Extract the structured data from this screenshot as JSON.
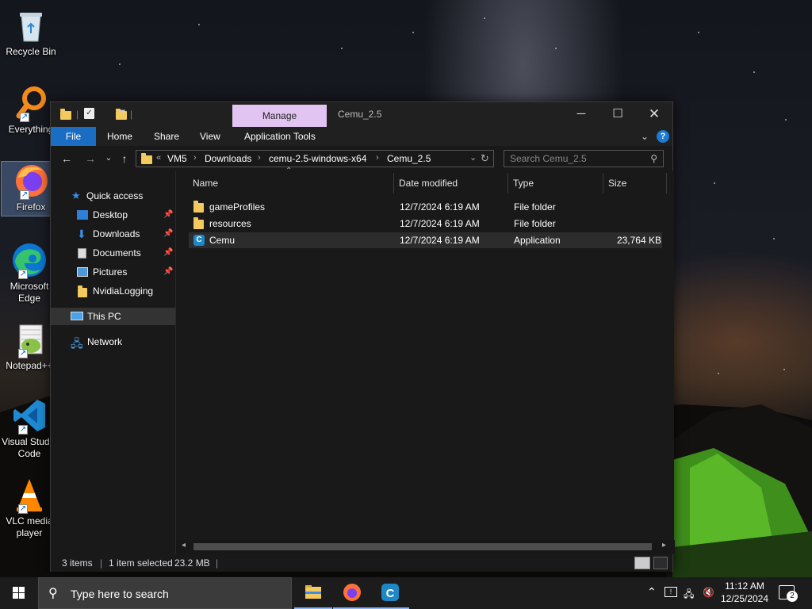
{
  "desktop": {
    "icons": [
      {
        "label": "Recycle Bin"
      },
      {
        "label": "Everything"
      },
      {
        "label": "Firefox"
      },
      {
        "label": "Microsoft Edge"
      },
      {
        "label": "Notepad++"
      },
      {
        "label": "Visual Studio Code"
      },
      {
        "label": "VLC media player"
      }
    ]
  },
  "window": {
    "title": "Cemu_2.5",
    "contextual_tab": "Manage",
    "ribbon_tabs": [
      "File",
      "Home",
      "Share",
      "View",
      "Application Tools"
    ],
    "breadcrumb": [
      "VM5",
      "Downloads",
      "cemu-2.5-windows-x64",
      "Cemu_2.5"
    ],
    "search_placeholder": "Search Cemu_2.5",
    "nav_pane": {
      "quick_access": "Quick access",
      "pinned": [
        "Desktop",
        "Downloads",
        "Documents",
        "Pictures"
      ],
      "other": "NvidiaLogging",
      "this_pc": "This PC",
      "network": "Network"
    },
    "columns": [
      "Name",
      "Date modified",
      "Type",
      "Size"
    ],
    "files": [
      {
        "name": "gameProfiles",
        "date": "12/7/2024 6:19 AM",
        "type": "File folder",
        "size": "",
        "icon": "folder-icon"
      },
      {
        "name": "resources",
        "date": "12/7/2024 6:19 AM",
        "type": "File folder",
        "size": "",
        "icon": "folder-icon"
      },
      {
        "name": "Cemu",
        "date": "12/7/2024 6:19 AM",
        "type": "Application",
        "size": "23,764 KB",
        "icon": "cemu-icon",
        "selected": true
      }
    ],
    "status": {
      "items": "3 items",
      "selection": "1 item selected",
      "size": "23.2 MB"
    }
  },
  "taskbar": {
    "search_placeholder": "Type here to search",
    "time": "11:12 AM",
    "date": "12/25/2024",
    "notification_count": "2"
  },
  "colors": {
    "accent": "#1a6dc2",
    "manage_tab": "#e2c4f2",
    "folder": "#f4c95d"
  }
}
